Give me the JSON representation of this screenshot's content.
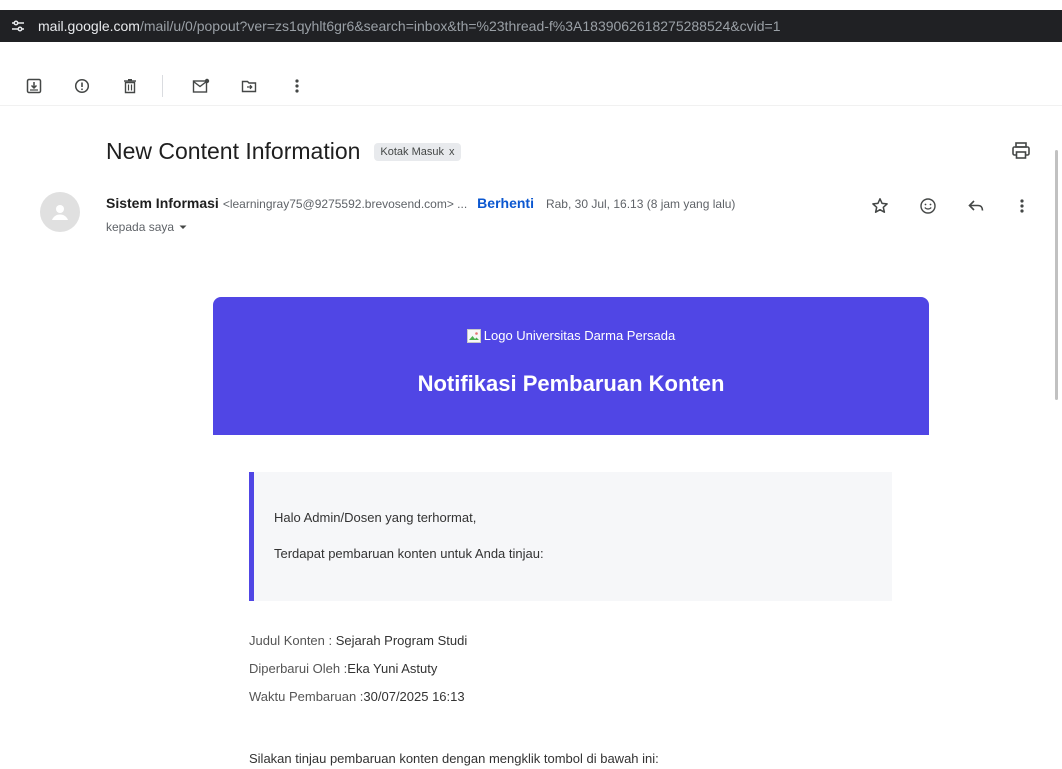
{
  "browser": {
    "url_host": "mail.google.com",
    "url_rest": "/mail/u/0/popout?ver=zs1qyhlt6gr6&search=inbox&th=%23thread-f%3A1839062618275288524&cvid=1"
  },
  "toolbar": {
    "icons": [
      "archive-icon",
      "report-spam-icon",
      "delete-icon",
      "mark-unread-icon",
      "move-to-icon",
      "more-vert-icon"
    ]
  },
  "email": {
    "subject": "New Content Information",
    "label_chip": "Kotak Masuk",
    "label_remove": "x",
    "sender_name": "Sistem Informasi",
    "sender_email": "<learningray75@9275592.brevosend.com> ...",
    "unsubscribe": "Berhenti",
    "date": "Rab, 30 Jul, 16.13 (8 jam yang lalu)",
    "to": "kepada saya"
  },
  "body": {
    "logo_alt": "Logo Universitas Darma Persada",
    "banner_title": "Notifikasi Pembaruan Konten",
    "greeting": "Halo Admin/Dosen yang terhormat,",
    "intro": "Terdapat pembaruan konten untuk Anda tinjau:",
    "details": [
      {
        "key": "Judul Konten :",
        "value": " Sejarah Program Studi"
      },
      {
        "key": "Diperbarui Oleh :",
        "value": "Eka Yuni Astuty"
      },
      {
        "key": "Waktu Pembaruan :",
        "value": "30/07/2025 16:13"
      }
    ],
    "review_prompt": "Silakan tinjau pembaruan konten dengan mengklik tombol di bawah ini:"
  },
  "colors": {
    "banner": "#5046e5",
    "link": "#0b57d0"
  }
}
